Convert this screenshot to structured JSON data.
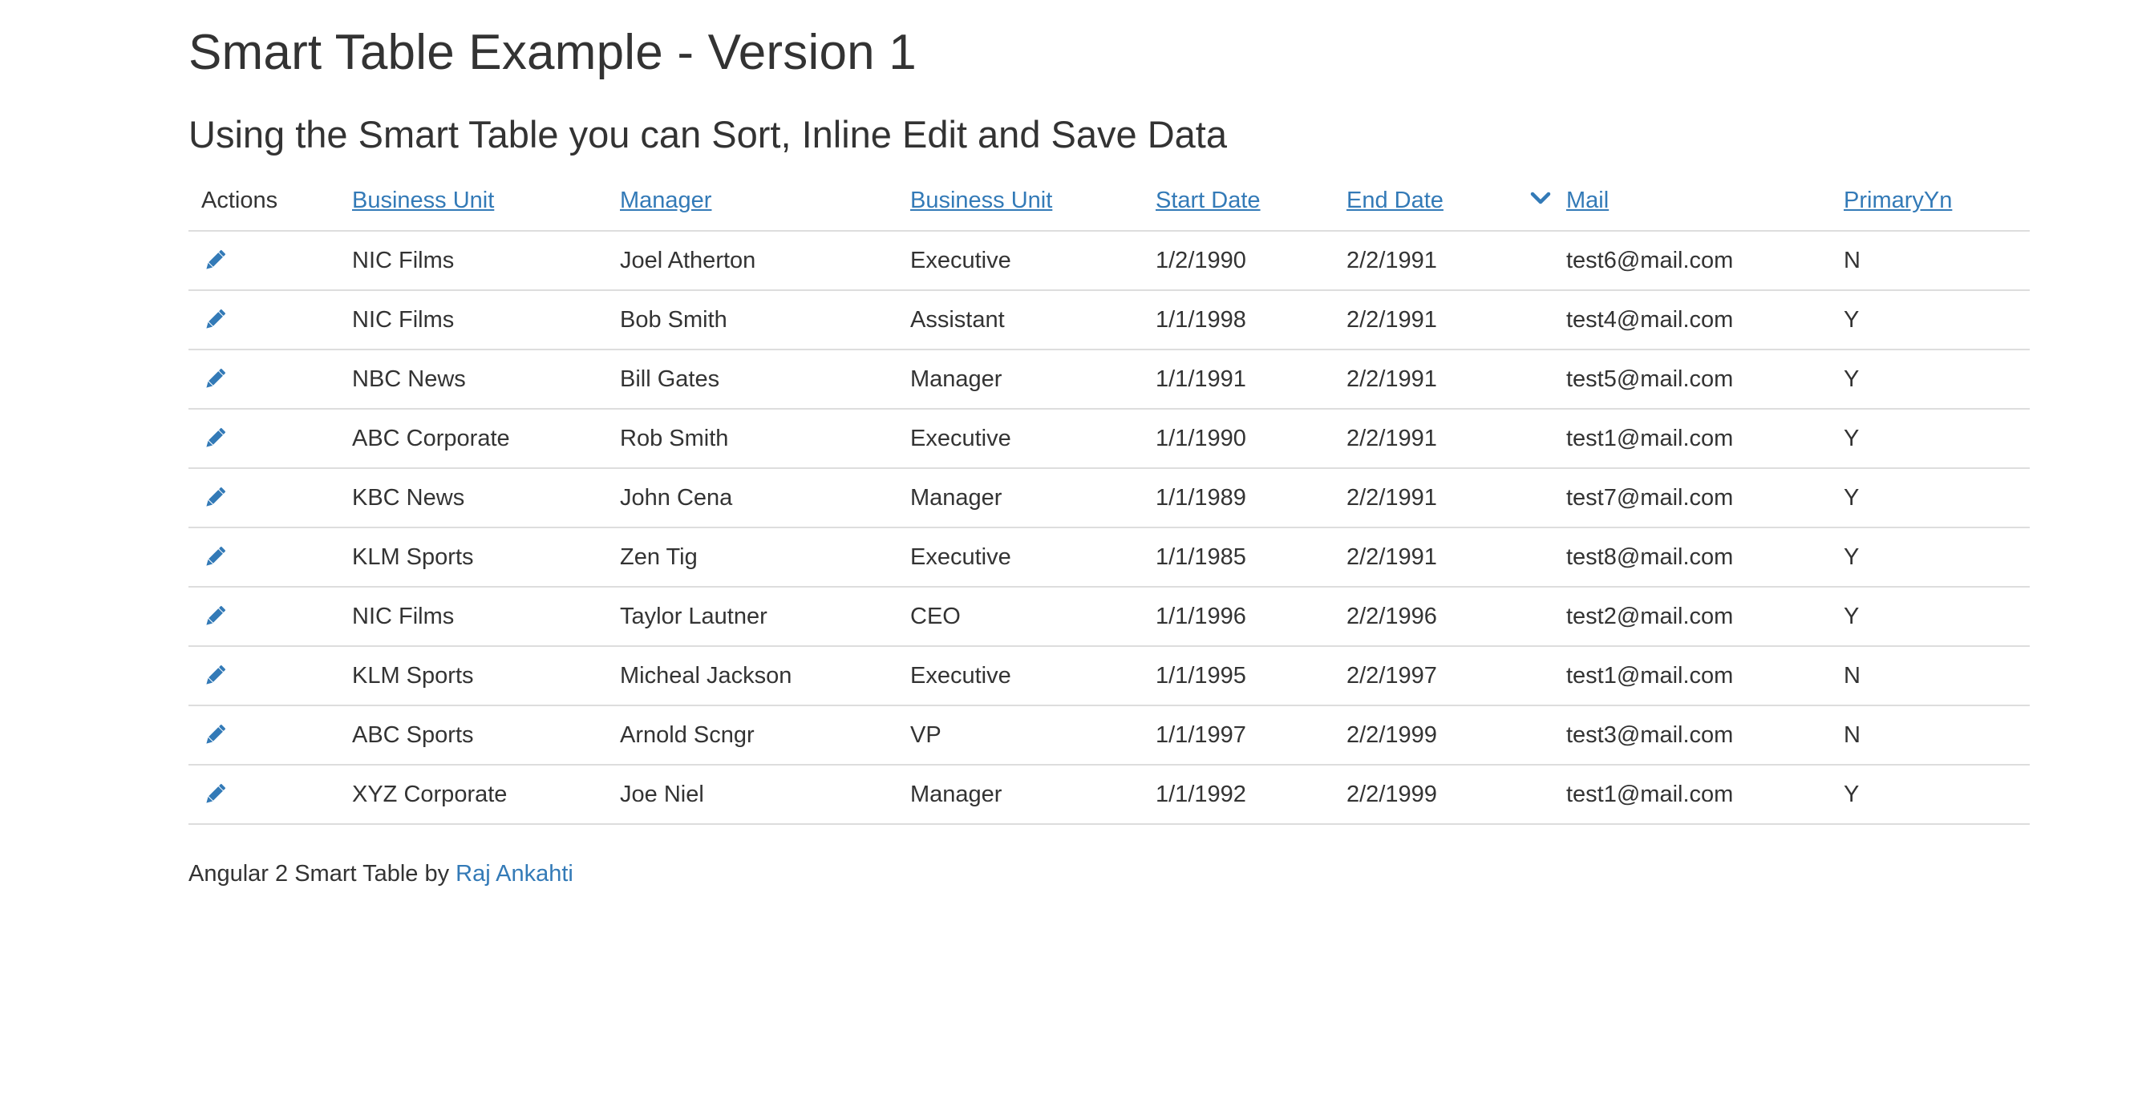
{
  "page": {
    "title": "Smart Table Example - Version 1",
    "subtitle": "Using the Smart Table you can Sort, Inline Edit and Save Data"
  },
  "table": {
    "columns": [
      {
        "label": "Actions",
        "sortable": false
      },
      {
        "label": "Business Unit",
        "sortable": true
      },
      {
        "label": "Manager",
        "sortable": true
      },
      {
        "label": "Business Unit",
        "sortable": true
      },
      {
        "label": "Start Date",
        "sortable": true
      },
      {
        "label": "End Date",
        "sortable": true,
        "sort_indicator": "chevron-down-icon"
      },
      {
        "label": "Mail",
        "sortable": true
      },
      {
        "label": "PrimaryYn",
        "sortable": true
      }
    ],
    "rows": [
      {
        "action_icon": "pencil-icon",
        "business_unit": "NIC Films",
        "manager": "Joel Atherton",
        "role": "Executive",
        "start_date": "1/2/1990",
        "end_date": "2/2/1991",
        "mail": "test6@mail.com",
        "primary": "N"
      },
      {
        "action_icon": "pencil-icon",
        "business_unit": "NIC Films",
        "manager": "Bob Smith",
        "role": "Assistant",
        "start_date": "1/1/1998",
        "end_date": "2/2/1991",
        "mail": "test4@mail.com",
        "primary": "Y"
      },
      {
        "action_icon": "pencil-icon",
        "business_unit": "NBC News",
        "manager": "Bill Gates",
        "role": "Manager",
        "start_date": "1/1/1991",
        "end_date": "2/2/1991",
        "mail": "test5@mail.com",
        "primary": "Y"
      },
      {
        "action_icon": "pencil-icon",
        "business_unit": "ABC Corporate",
        "manager": "Rob Smith",
        "role": "Executive",
        "start_date": "1/1/1990",
        "end_date": "2/2/1991",
        "mail": "test1@mail.com",
        "primary": "Y"
      },
      {
        "action_icon": "pencil-icon",
        "business_unit": "KBC News",
        "manager": "John Cena",
        "role": "Manager",
        "start_date": "1/1/1989",
        "end_date": "2/2/1991",
        "mail": "test7@mail.com",
        "primary": "Y"
      },
      {
        "action_icon": "pencil-icon",
        "business_unit": "KLM Sports",
        "manager": "Zen Tig",
        "role": "Executive",
        "start_date": "1/1/1985",
        "end_date": "2/2/1991",
        "mail": "test8@mail.com",
        "primary": "Y"
      },
      {
        "action_icon": "pencil-icon",
        "business_unit": "NIC Films",
        "manager": "Taylor Lautner",
        "role": "CEO",
        "start_date": "1/1/1996",
        "end_date": "2/2/1996",
        "mail": "test2@mail.com",
        "primary": "Y"
      },
      {
        "action_icon": "pencil-icon",
        "business_unit": "KLM Sports",
        "manager": "Micheal Jackson",
        "role": "Executive",
        "start_date": "1/1/1995",
        "end_date": "2/2/1997",
        "mail": "test1@mail.com",
        "primary": "N"
      },
      {
        "action_icon": "pencil-icon",
        "business_unit": "ABC Sports",
        "manager": "Arnold Scngr",
        "role": "VP",
        "start_date": "1/1/1997",
        "end_date": "2/2/1999",
        "mail": "test3@mail.com",
        "primary": "N"
      },
      {
        "action_icon": "pencil-icon",
        "business_unit": "XYZ Corporate",
        "manager": "Joe Niel",
        "role": "Manager",
        "start_date": "1/1/1992",
        "end_date": "2/2/1999",
        "mail": "test1@mail.com",
        "primary": "Y"
      }
    ]
  },
  "footer": {
    "text": "Angular 2 Smart Table by ",
    "author_link": "Raj Ankahti"
  },
  "colors": {
    "link": "#337ab7",
    "text": "#333333",
    "border": "#dddddd"
  }
}
